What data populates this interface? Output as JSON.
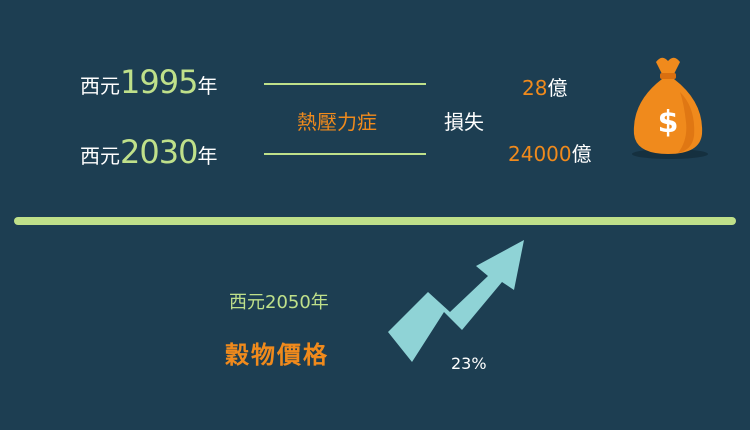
{
  "row1": {
    "prefix": "西元",
    "year": "1995",
    "suffix": "年"
  },
  "row2": {
    "prefix": "西元",
    "year": "2030",
    "suffix": "年"
  },
  "cause_label": "熱壓力症",
  "loss_label": "損失",
  "value1": {
    "number": "28",
    "unit": "億"
  },
  "value2": {
    "number": "24000",
    "unit": "億"
  },
  "lower": {
    "year_text": "西元2050年",
    "crop_label": "穀物價格",
    "percent": "23%"
  },
  "icons": [
    "money-bag-icon",
    "up-arrow-icon"
  ],
  "colors": {
    "background": "#1d3e52",
    "green": "#bfe08a",
    "orange": "#f08a1c",
    "arrow": "#8fd3d6"
  }
}
